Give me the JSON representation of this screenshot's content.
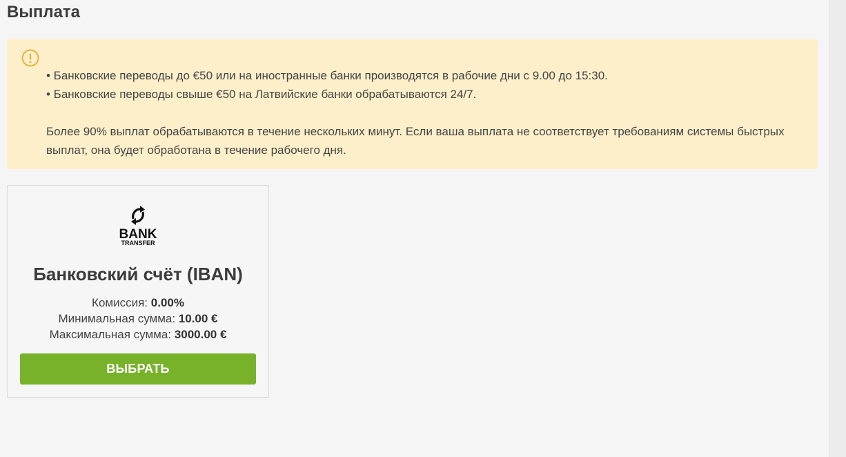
{
  "page": {
    "title": "Выплата"
  },
  "notice": {
    "icon": "exclamation-circle-icon",
    "icon_color": "#e5b33a",
    "background": "#fdefca",
    "lines": [
      "• Банковские переводы до €50 или на иностранные банки производятся в рабочие дни с 9.00 до 15:30.",
      "• Банковские переводы свыше €50 на Латвийские банки обрабатываются 24/7."
    ],
    "paragraph": "Более 90% выплат обрабатываются в течение нескольких минут. Если ваша выплата не соответствует требованиям системы быстрых выплат, она будет обработана в течение рабочего дня."
  },
  "method": {
    "logo": {
      "icon": "bank-transfer-logo",
      "line1": "BANK",
      "line2": "TRANSFER"
    },
    "title": "Банковский счёт (IBAN)",
    "commission_label": "Комиссия:",
    "commission_value": "0.00%",
    "min_label": "Минимальная сумма:",
    "min_value": "10.00 €",
    "max_label": "Максимальная сумма:",
    "max_value": "3000.00 €",
    "button_label": "ВЫБРАТЬ",
    "button_color": "#77b22a"
  }
}
